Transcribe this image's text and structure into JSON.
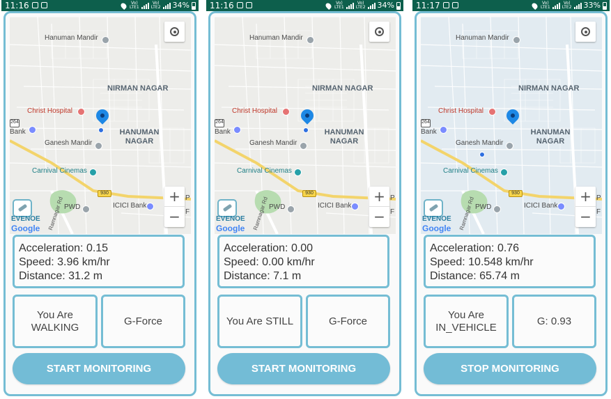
{
  "screens": [
    {
      "status": {
        "time": "11:16",
        "carrier": "Vo)) 4G LTE1",
        "carrier2": "Vo)) LTE2",
        "battery": "34%"
      },
      "map": {
        "labels": {
          "hanuman_mandir": "Hanuman Mandir",
          "nirman_nagar": "NIRMAN NAGAR",
          "christ_hospital": "Christ Hospital",
          "hanuman_nagar": "HANUMAN NAGAR",
          "ganesh_mandir": "Ganesh Mandir",
          "carnival": "Carnival Cinemas",
          "pwd": "PWD",
          "icici": "ICICI Bank",
          "bank": "Bank",
          "ramnagar_rd": "Ramnagar Rd",
          "route_930": "930",
          "route_264": "264",
          "edge_p": "P",
          "edge_f": "F"
        },
        "zoom_in": "+",
        "zoom_out": "−",
        "logo_text": "EVENOE",
        "attribution": "Google",
        "tinted": false
      },
      "stats": {
        "acceleration": "Acceleration: 0.15",
        "speed": "Speed: 3.96 km/hr",
        "distance": "Distance: 31.2 m"
      },
      "activity": "You Are\nWALKING",
      "gforce": "G-Force",
      "button": "START MONITORING"
    },
    {
      "status": {
        "time": "11:16",
        "carrier": "Vo)) 4G LTE1",
        "carrier2": "Vo)) LTE2",
        "battery": "34%"
      },
      "map": {
        "labels": {
          "hanuman_mandir": "Hanuman Mandir",
          "nirman_nagar": "NIRMAN NAGAR",
          "christ_hospital": "Christ Hospital",
          "hanuman_nagar": "HANUMAN NAGAR",
          "ganesh_mandir": "Ganesh Mandir",
          "carnival": "Carnival Cinemas",
          "pwd": "PWD",
          "icici": "ICICI Bank",
          "bank": "Bank",
          "ramnagar_rd": "Ramnagar Rd",
          "route_930": "930",
          "route_264": "264",
          "edge_p": "P",
          "edge_f": "F"
        },
        "zoom_in": "+",
        "zoom_out": "−",
        "logo_text": "EVENOE",
        "attribution": "Google",
        "tinted": false
      },
      "stats": {
        "acceleration": "Acceleration: 0.00",
        "speed": "Speed: 0.00 km/hr",
        "distance": "Distance: 7.1 m"
      },
      "activity": "You Are STILL",
      "gforce": "G-Force",
      "button": "START MONITORING"
    },
    {
      "status": {
        "time": "11:17",
        "carrier": "Vo)) 4G LTE1",
        "carrier2": "Vo)) LTE2",
        "battery": "33%"
      },
      "map": {
        "labels": {
          "hanuman_mandir": "Hanuman Mandir",
          "nirman_nagar": "NIRMAN NAGAR",
          "christ_hospital": "Christ Hospital",
          "hanuman_nagar": "HANUMAN NAGAR",
          "ganesh_mandir": "Ganesh Mandir",
          "carnival": "Carnival Cinemas",
          "pwd": "PWD",
          "icici": "ICICI Bank",
          "bank": "Bank",
          "ramnagar_rd": "Ramnagar Rd",
          "route_930": "930",
          "route_264": "264",
          "edge_p": "P",
          "edge_f": "F"
        },
        "zoom_in": "+",
        "zoom_out": "−",
        "logo_text": "EVENOE",
        "attribution": "Google",
        "tinted": true
      },
      "stats": {
        "acceleration": "Acceleration: 0.76",
        "speed": "Speed: 10.548 km/hr",
        "distance": "Distance: 65.74 m"
      },
      "activity": "You Are\nIN_VEHICLE",
      "gforce": "G: 0.93",
      "button": "STOP MONITORING"
    }
  ],
  "theme": {
    "status_bar": "#0d5f4c",
    "accent_border": "#75bdd4",
    "button_fill": "#73bcd6",
    "marker_blue": "#1e88e5"
  },
  "icons": {
    "status_left": [
      "image-icon",
      "message-icon"
    ],
    "location": "my-location-icon",
    "marker": "map-pin-icon",
    "poi": "place-icon",
    "hospital": "hospital-icon",
    "bank": "bank-icon",
    "cinema": "cinema-icon"
  }
}
